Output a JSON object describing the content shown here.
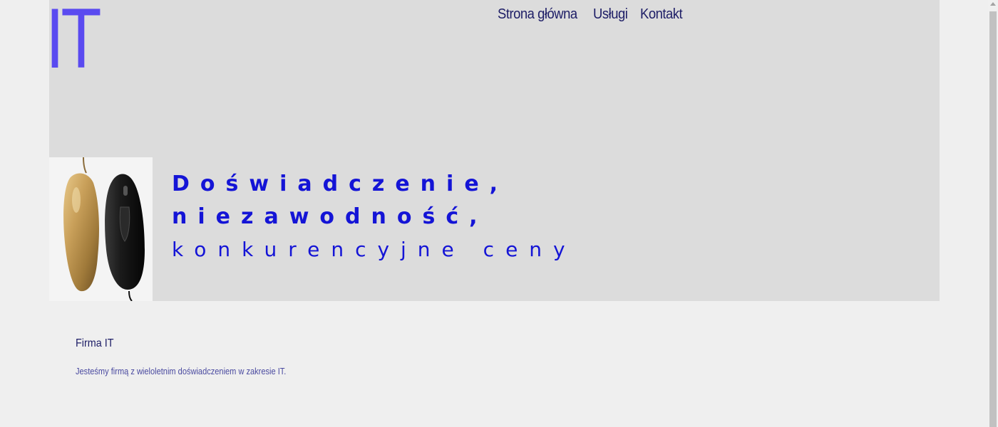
{
  "header": {
    "logo": "IT",
    "nav": [
      {
        "label": "Strona główna"
      },
      {
        "label": "Usługi"
      },
      {
        "label": "Kontakt"
      }
    ]
  },
  "hero": {
    "image_description_icon": "computer-mice-image",
    "tagline": {
      "line1": "Doświadczenie,",
      "line2": "niezawodność,",
      "line3": "konkurencyjne ceny"
    }
  },
  "content": {
    "title": "Firma IT",
    "text": "Jesteśmy firmą z wieloletnim doświadczeniem w zakresie IT."
  },
  "colors": {
    "logo": "#5a4af0",
    "nav": "#1d1d66",
    "tagline": "#1414d6",
    "header_bg": "#dcdcdc",
    "page_bg": "#efefef"
  }
}
